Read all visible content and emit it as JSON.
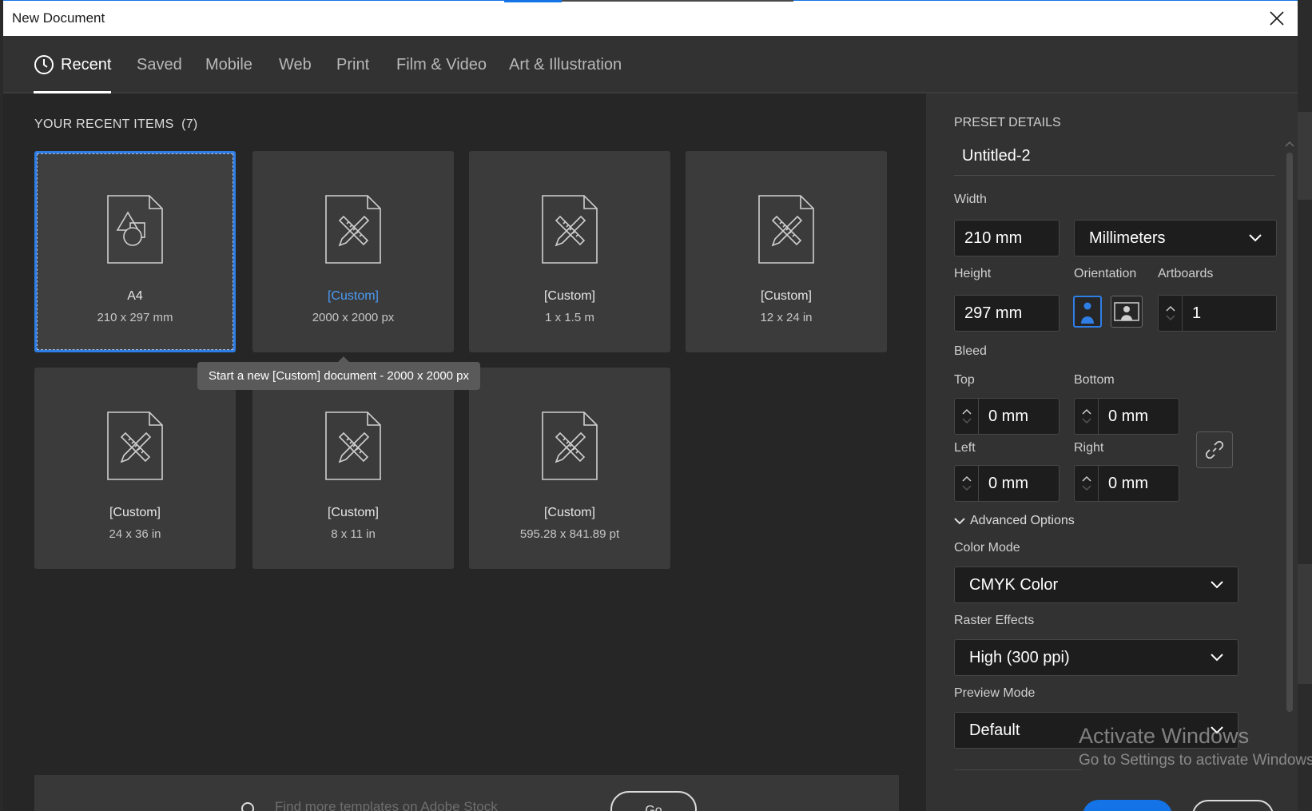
{
  "window": {
    "title": "New Document"
  },
  "tabs": [
    {
      "label": "Recent",
      "active": true
    },
    {
      "label": "Saved"
    },
    {
      "label": "Mobile"
    },
    {
      "label": "Web"
    },
    {
      "label": "Print"
    },
    {
      "label": "Film & Video"
    },
    {
      "label": "Art & Illustration"
    }
  ],
  "recent": {
    "heading": "YOUR RECENT ITEMS",
    "count": "(7)",
    "items": [
      {
        "name": "A4",
        "size": "210 x 297 mm",
        "icon": "shape-document-icon",
        "selected": true
      },
      {
        "name": "[Custom]",
        "size": "2000 x 2000 px",
        "icon": "custom-document-icon",
        "hovered": true
      },
      {
        "name": "[Custom]",
        "size": "1 x 1.5 m",
        "icon": "custom-document-icon"
      },
      {
        "name": "[Custom]",
        "size": "12 x 24 in",
        "icon": "custom-document-icon"
      },
      {
        "name": "[Custom]",
        "size": "24 x 36 in",
        "icon": "custom-document-icon"
      },
      {
        "name": "[Custom]",
        "size": "8 x 11 in",
        "icon": "custom-document-icon"
      },
      {
        "name": "[Custom]",
        "size": "595.28 x 841.89 pt",
        "icon": "custom-document-icon"
      }
    ],
    "tooltip": "Start a new [Custom] document - 2000 x 2000 px"
  },
  "stock": {
    "placeholder": "Find more templates on Adobe Stock",
    "go_label": "Go"
  },
  "preset": {
    "heading": "PRESET DETAILS",
    "doc_name": "Untitled-2",
    "width_label": "Width",
    "width_value": "210 mm",
    "units": "Millimeters",
    "height_label": "Height",
    "height_value": "297 mm",
    "orientation_label": "Orientation",
    "artboards_label": "Artboards",
    "artboards_value": "1",
    "bleed_label": "Bleed",
    "bleed": {
      "top_label": "Top",
      "top_value": "0 mm",
      "bottom_label": "Bottom",
      "bottom_value": "0 mm",
      "left_label": "Left",
      "left_value": "0 mm",
      "right_label": "Right",
      "right_value": "0 mm"
    },
    "advanced_label": "Advanced Options",
    "color_mode_label": "Color Mode",
    "color_mode_value": "CMYK Color",
    "raster_label": "Raster Effects",
    "raster_value": "High (300 ppi)",
    "preview_label": "Preview Mode",
    "preview_value": "Default"
  },
  "watermark": {
    "line1": "Activate Windows",
    "line2": "Go to Settings to activate Windows."
  },
  "colors": {
    "accent": "#1473e6",
    "selection": "#2f7ee6",
    "link": "#4b9cf5"
  }
}
